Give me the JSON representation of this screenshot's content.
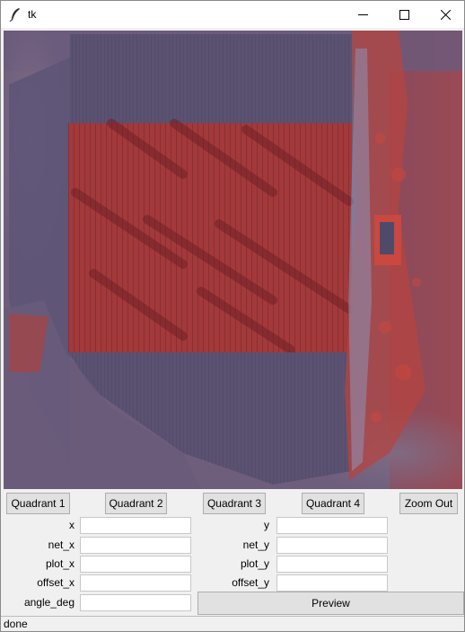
{
  "window": {
    "title": "tk",
    "icon": "feather-icon",
    "controls": [
      "minimize-icon",
      "maximize-icon",
      "close-icon"
    ]
  },
  "canvas": {
    "description_icon": "aerial-image",
    "colors": {
      "base": "#5e5577",
      "field": "#a03a3c",
      "accent_red": "#c4463f"
    }
  },
  "buttons": {
    "quadrant1": "Quadrant 1",
    "quadrant2": "Quadrant 2",
    "quadrant3": "Quadrant 3",
    "quadrant4": "Quadrant 4",
    "zoom_out": "Zoom Out",
    "preview": "Preview"
  },
  "fields_left": [
    {
      "label": "x",
      "value": ""
    },
    {
      "label": "net_x",
      "value": ""
    },
    {
      "label": "plot_x",
      "value": ""
    },
    {
      "label": "offset_x",
      "value": ""
    },
    {
      "label": "angle_deg",
      "value": ""
    }
  ],
  "fields_right": [
    {
      "label": "y",
      "value": ""
    },
    {
      "label": "net_y",
      "value": ""
    },
    {
      "label": "plot_y",
      "value": ""
    },
    {
      "label": "offset_y",
      "value": ""
    }
  ],
  "status": {
    "text": "done"
  }
}
